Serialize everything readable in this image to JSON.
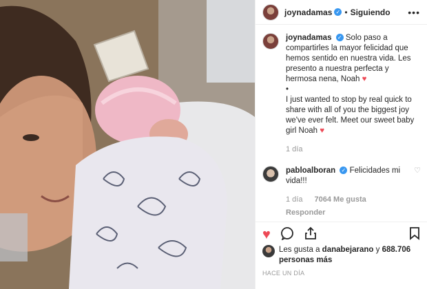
{
  "post": {
    "author": "joynadamas",
    "dot": "•",
    "follow_label": "Siguiendo",
    "more_label": "•••",
    "verified_glyph": "✓"
  },
  "caption": {
    "author": "joynadamas",
    "text_es": "Solo paso a compartirles la mayor felicidad que hemos sentido en nuestra vida. Les presento a nuestra perfecta y hermosa nena, Noah",
    "bullet": "•",
    "text_en": "I just wanted to stop by real quick to share with all of you the biggest joy we've ever felt. Meet our sweet baby girl Noah",
    "heart": "♥",
    "time": "1 día"
  },
  "comment": {
    "author": "pabloalboran",
    "text": "Felicidades mi vida!!!",
    "time": "1 día",
    "likes": "7064 Me gusta",
    "reply_label": "Responder"
  },
  "likes_summary": {
    "prefix": "Les gusta a",
    "user": "danabejarano",
    "connector": "y",
    "count_text": "688.706 personas más"
  },
  "timestamp": "HACE UN DÍA",
  "icons": [
    "heart-icon",
    "comment-icon",
    "share-icon",
    "bookmark-icon",
    "small-heart-icon"
  ],
  "colors": {
    "accent": "#3897f0",
    "like": "#ed4956",
    "muted": "#999999"
  }
}
